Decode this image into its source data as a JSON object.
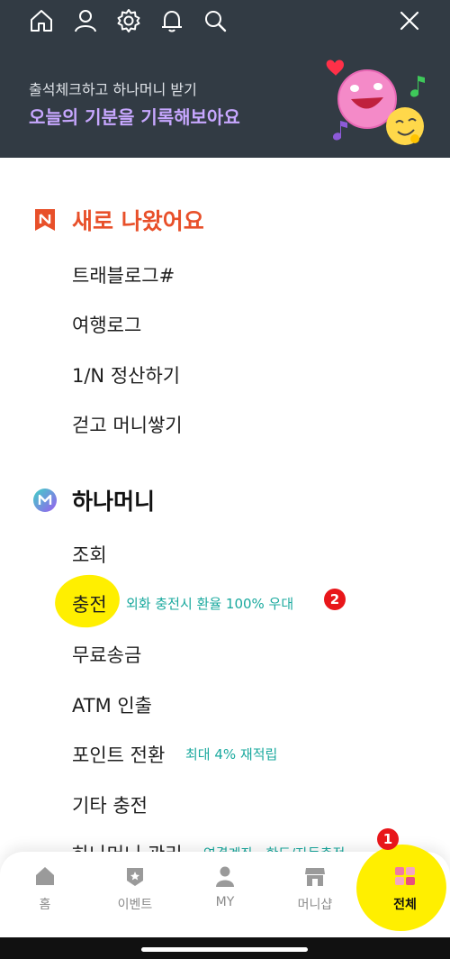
{
  "colors": {
    "header_bg": "#323b44",
    "accent_purple": "#c7a7ff",
    "new_section": "#e8502a",
    "note_teal": "#1aa99e",
    "highlight": "#ffef00",
    "badge_red": "#e8161a"
  },
  "topbar": {
    "icons": [
      "home-icon",
      "person-icon",
      "gear-icon",
      "bell-icon",
      "search-icon",
      "close-icon"
    ]
  },
  "promo": {
    "line1": "출석체크하고 하나머니 받기",
    "line2": "오늘의 기분을 기록해보아요"
  },
  "sections": {
    "new": {
      "title": "새로 나왔어요",
      "items": [
        "트래블로그#",
        "여행로그",
        "1/N 정산하기",
        "걷고 머니쌓기"
      ]
    },
    "hanamoney": {
      "title": "하나머니",
      "items": [
        "조회",
        "충전",
        "무료송금",
        "ATM 인출",
        "포인트 전환",
        "기타 충전",
        "하나머니 관리"
      ],
      "notes": {
        "charge": "외화 충전시 환율 100% 우대",
        "point": "최대 4% 재적립",
        "manage": "연결계좌 · 한도/자동충전"
      }
    }
  },
  "badges": {
    "one": "1",
    "two": "2"
  },
  "tabbar": {
    "tabs": [
      {
        "label": "홈",
        "icon": "home-icon"
      },
      {
        "label": "이벤트",
        "icon": "event-icon"
      },
      {
        "label": "MY",
        "icon": "person-icon"
      },
      {
        "label": "머니샵",
        "icon": "shop-icon"
      },
      {
        "label": "전체",
        "icon": "menu-all-icon"
      }
    ],
    "active_index": 4
  }
}
